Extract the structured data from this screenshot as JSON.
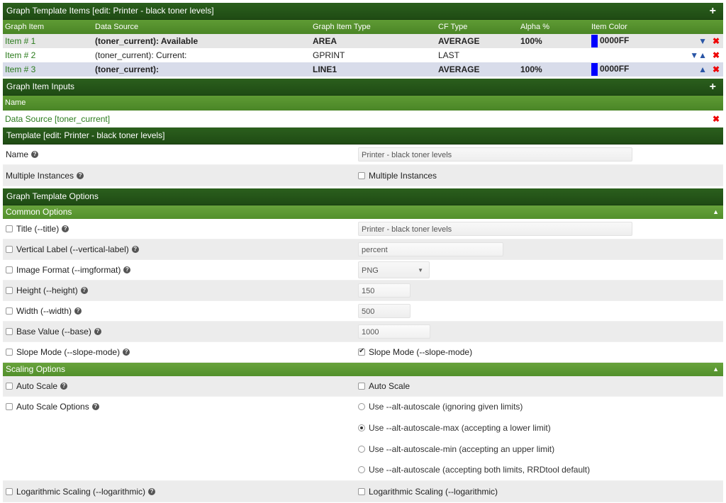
{
  "items_section": {
    "title": "Graph Template Items [edit: Printer - black toner levels]",
    "columns": [
      "Graph Item",
      "Data Source",
      "Graph Item Type",
      "CF Type",
      "Alpha %",
      "Item Color"
    ],
    "rows": [
      {
        "item": "Item # 1",
        "source": "(toner_current): Available",
        "type": "AREA",
        "cf": "AVERAGE",
        "alpha": "100%",
        "color": "0000FF",
        "moves": "▼"
      },
      {
        "item": "Item # 2",
        "source": "(toner_current): Current:",
        "type": "GPRINT",
        "cf": "LAST",
        "alpha": "",
        "color": "",
        "moves": "▼▲"
      },
      {
        "item": "Item # 3",
        "source": "(toner_current):",
        "type": "LINE1",
        "cf": "AVERAGE",
        "alpha": "100%",
        "color": "0000FF",
        "moves": "▲"
      }
    ]
  },
  "inputs_section": {
    "title": "Graph Item Inputs",
    "column": "Name",
    "item": "Data Source [toner_current]"
  },
  "template_section": {
    "title": "Template [edit: Printer - black toner levels]",
    "name_label": "Name",
    "name_value": "Printer - black toner levels",
    "multi_label": "Multiple Instances",
    "multi_checkbox": "Multiple Instances"
  },
  "options_section": {
    "title": "Graph Template Options",
    "common_title": "Common Options",
    "common": [
      {
        "label": "Title (--title)",
        "value": "Printer - black toner levels"
      },
      {
        "label": "Vertical Label (--vertical-label)",
        "value": "percent"
      },
      {
        "label": "Image Format (--imgformat)",
        "value": "PNG"
      },
      {
        "label": "Height (--height)",
        "value": "150"
      },
      {
        "label": "Width (--width)",
        "value": "500"
      },
      {
        "label": "Base Value (--base)",
        "value": "1000"
      },
      {
        "label": "Slope Mode (--slope-mode)",
        "value": "Slope Mode (--slope-mode)"
      }
    ],
    "scaling_title": "Scaling Options",
    "auto_scale_label": "Auto Scale",
    "auto_scale_checkbox": "Auto Scale",
    "auto_scale_options_label": "Auto Scale Options",
    "radios": [
      "Use --alt-autoscale (ignoring given limits)",
      "Use --alt-autoscale-max (accepting a lower limit)",
      "Use --alt-autoscale-min (accepting an upper limit)",
      "Use --alt-autoscale (accepting both limits, RRDtool default)"
    ],
    "radio_selected": 1,
    "log_label": "Logarithmic Scaling (--logarithmic)",
    "log_checkbox": "Logarithmic Scaling (--logarithmic)"
  },
  "icons": {
    "add": "plus-icon",
    "delete": "delete-x-icon",
    "help": "help-icon",
    "collapse": "caret-up-icon",
    "dropdown": "caret-down-icon"
  },
  "glyphs": {
    "plus": "+",
    "delete": "✖",
    "help": "?",
    "caret": "▲",
    "dropdown": "▼"
  },
  "colors": {
    "header": "#1f4b14",
    "subheader": "#4a8526",
    "swatch": "#0000ff",
    "delete": "#e00000",
    "link": "#2a7b1c"
  }
}
